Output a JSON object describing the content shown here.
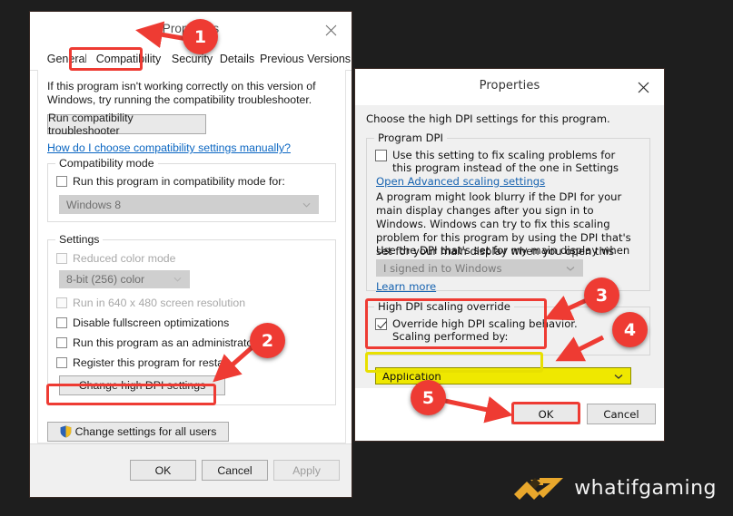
{
  "page": {
    "background_color": "#1e1e1e",
    "accent_color": "#ee3b33",
    "highlight_color": "#efe800"
  },
  "dialog1": {
    "title": "Properties",
    "close_icon": "close-icon",
    "tabs": [
      {
        "label": "General",
        "active": false
      },
      {
        "label": "Compatibility",
        "active": true
      },
      {
        "label": "Security",
        "active": false
      },
      {
        "label": "Details",
        "active": false
      },
      {
        "label": "Previous Versions",
        "active": false
      }
    ],
    "intro_text": "If this program isn't working correctly on this version of Windows, try running the compatibility troubleshooter.",
    "troubleshooter_button": "Run compatibility troubleshooter",
    "help_link": "How do I choose compatibility settings manually?",
    "compat_group": {
      "label": "Compatibility mode",
      "checkbox_label": "Run this program in compatibility mode for:",
      "checkbox_checked": false,
      "combo_value": "Windows 8",
      "combo_enabled": false
    },
    "settings_group": {
      "label": "Settings",
      "items": [
        {
          "label": "Reduced color mode",
          "checked": false,
          "disabled": true
        },
        {
          "label": "Run in 640 x 480 screen resolution",
          "checked": false,
          "disabled": true
        },
        {
          "label": "Disable fullscreen optimizations",
          "checked": false,
          "disabled": false
        },
        {
          "label": "Run this program as an administrator",
          "checked": false,
          "disabled": false
        },
        {
          "label": "Register this program for restart",
          "checked": false,
          "disabled": false
        }
      ],
      "color_combo_value": "8-bit (256) color",
      "color_combo_enabled": false,
      "dpi_button": "Change high DPI settings"
    },
    "all_users_button": "Change settings for all users",
    "all_users_icon": "shield-icon",
    "footer_buttons": [
      {
        "label": "OK",
        "disabled": false
      },
      {
        "label": "Cancel",
        "disabled": false
      },
      {
        "label": "Apply",
        "disabled": true
      }
    ]
  },
  "dialog2": {
    "title": "Properties",
    "close_icon": "close-icon",
    "intro_text": "Choose the high DPI settings for this program.",
    "program_dpi_group": {
      "label": "Program DPI",
      "checkbox_label": "Use this setting to fix scaling problems for this program instead of the one in Settings",
      "checkbox_checked": false,
      "advanced_link": "Open Advanced scaling settings",
      "body_text": "A program might look blurry if the DPI for your main display changes after you sign in to Windows. Windows can try to fix this scaling problem for this program by using the DPI that's set for your main display when you open this program.",
      "dropdown_label": "Use the DPI that's set for my main display when",
      "dropdown_value": "I signed in to Windows",
      "dropdown_enabled": false,
      "learn_more_link": "Learn more"
    },
    "override_group": {
      "label": "High DPI scaling override",
      "checkbox_label_line1": "Override high DPI scaling behavior.",
      "checkbox_label_line2": "Scaling performed by:",
      "checkbox_checked": true,
      "combo_value": "Application",
      "combo_highlighted": true
    },
    "footer_buttons": [
      {
        "label": "OK",
        "disabled": false
      },
      {
        "label": "Cancel",
        "disabled": false
      }
    ]
  },
  "annotations": {
    "callouts": [
      {
        "number": "1",
        "target": "compatibility-tab"
      },
      {
        "number": "2",
        "target": "change-high-dpi-settings-button"
      },
      {
        "number": "3",
        "target": "high-dpi-scaling-override-group"
      },
      {
        "number": "4",
        "target": "scaling-performed-by-combo"
      },
      {
        "number": "5",
        "target": "dialog2-ok-button"
      }
    ]
  },
  "watermark": {
    "text": "whatifgaming",
    "icon": "whatifgaming-logo-icon",
    "color": "#e8a72c"
  }
}
